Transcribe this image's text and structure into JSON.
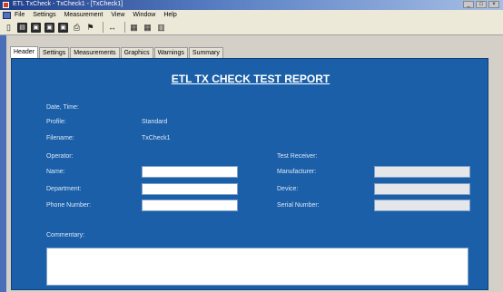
{
  "window": {
    "title": "ETL TxCheck - TxCheck1 - [TxCheck1]",
    "buttons": [
      "_",
      "□",
      "×"
    ]
  },
  "menu": [
    "File",
    "Settings",
    "Measurement",
    "View",
    "Window",
    "Help"
  ],
  "toolbar": {
    "icons": [
      "new-icon",
      "open-icon",
      "save-icon",
      "save-as-icon",
      "save-all-icon",
      "print-icon",
      "measure-icon",
      "range-icon",
      "chart-icon",
      "grid-icon",
      "report-icon"
    ]
  },
  "tabs": [
    "Header",
    "Settings",
    "Measurements",
    "Graphics",
    "Warnings",
    "Summary"
  ],
  "active_tab": "Header",
  "report": {
    "title": "ETL TX CHECK TEST REPORT",
    "date_time_label": "Date, Time:",
    "profile_label": "Profile:",
    "profile_value": "Standard",
    "filename_label": "Filename:",
    "filename_value": "TxCheck1",
    "operator_label": "Operator:",
    "name_label": "Name:",
    "department_label": "Department:",
    "phone_label": "Phone Number:",
    "test_receiver_label": "Test Receiver:",
    "manufacturer_label": "Manufacturer:",
    "device_label": "Device:",
    "serial_label": "Serial Number:",
    "commentary_label": "Commentary:",
    "fields": {
      "name": "",
      "department": "",
      "phone": "",
      "manufacturer": "",
      "device": "",
      "serial": "",
      "commentary": ""
    }
  },
  "colors": {
    "panel": "#1a5fa8",
    "title_text": "#ffffff"
  }
}
